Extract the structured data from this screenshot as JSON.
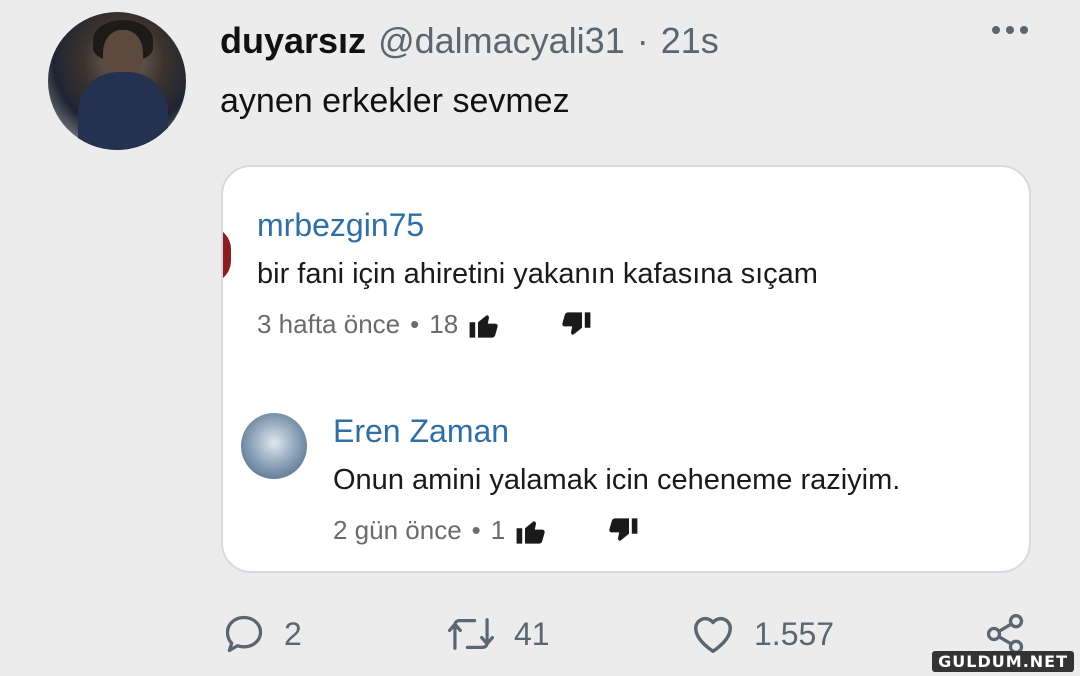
{
  "tweet": {
    "author_name": "duyarsız",
    "handle": "@dalmacyali31",
    "separator": "·",
    "time": "21s",
    "text": "aynen erkekler sevmez"
  },
  "embedded": {
    "comment1": {
      "author": "mrbezgin75",
      "text": "bir fani için ahiretini yakanın kafasına sıçam",
      "time": "3 hafta önce",
      "dot": "•",
      "likes": "18"
    },
    "comment2": {
      "author": "Eren Zaman",
      "text": "Onun amini yalamak icin ceheneme raziyim.",
      "time": "2 gün önce",
      "dot": "•",
      "likes": "1"
    }
  },
  "actions": {
    "replies": "2",
    "retweets": "41",
    "likes": "1.557"
  },
  "watermark": "GULDUM.NET",
  "icons": {
    "more": "more-horizontal-icon",
    "reply": "reply-icon",
    "retweet": "retweet-icon",
    "like": "heart-icon",
    "share": "share-icon",
    "thumb_up": "thumbs-up-icon",
    "thumb_down": "thumbs-down-icon"
  },
  "colors": {
    "background": "#ececec",
    "card": "#ffffff",
    "link_blue": "#2f6fa3",
    "muted": "#5b6670"
  }
}
